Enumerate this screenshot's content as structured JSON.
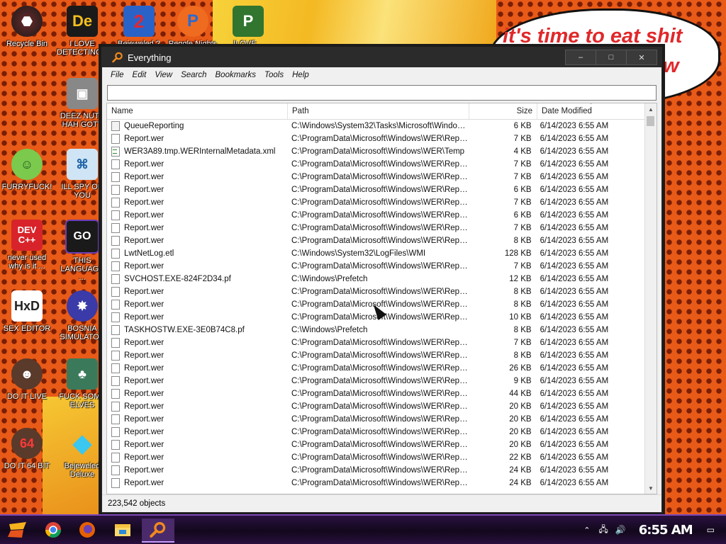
{
  "speech_bubble": {
    "line1": "it's time to eat shit",
    "line2": "w"
  },
  "desktop_icons": [
    {
      "label": "Recycle Bin"
    },
    {
      "label": "I LOVE DETECTING..."
    },
    {
      "label": "Bejeweled 2"
    },
    {
      "label": "Peggle Nights"
    },
    {
      "label": "ILOVE..."
    },
    {
      "label": "DEEZ NUTS HAH GOTT"
    },
    {
      "label": "FURRYFUCK!"
    },
    {
      "label": "ILL SPY ON YOU"
    },
    {
      "label": "never used why is it ..."
    },
    {
      "label": "THIS LANGUAGE ..."
    },
    {
      "label": "SEX EDITOR"
    },
    {
      "label": "BOSNIA SIMULATOR"
    },
    {
      "label": "DO IT LIVE"
    },
    {
      "label": "FUCK SOME ELVES"
    },
    {
      "label": "DO IT 64 BIT"
    },
    {
      "label": "Bejeweled Deluxe"
    }
  ],
  "window": {
    "title": "Everything",
    "minimize": "–",
    "maximize": "□",
    "close": "✕",
    "menu": [
      "File",
      "Edit",
      "View",
      "Search",
      "Bookmarks",
      "Tools",
      "Help"
    ],
    "search": {
      "value": "",
      "placeholder": ""
    },
    "columns": {
      "name": "Name",
      "path": "Path",
      "size": "Size",
      "date": "Date Modified"
    },
    "rows": [
      {
        "icon": "folder",
        "name": "QueueReporting",
        "path": "C:\\Windows\\System32\\Tasks\\Microsoft\\Windows...",
        "size": "6 KB",
        "date": "6/14/2023 6:55 AM"
      },
      {
        "icon": "file",
        "name": "Report.wer",
        "path": "C:\\ProgramData\\Microsoft\\Windows\\WER\\Report...",
        "size": "7 KB",
        "date": "6/14/2023 6:55 AM"
      },
      {
        "icon": "xml",
        "name": "WER3A89.tmp.WERInternalMetadata.xml",
        "path": "C:\\ProgramData\\Microsoft\\Windows\\WER\\Temp",
        "size": "4 KB",
        "date": "6/14/2023 6:55 AM"
      },
      {
        "icon": "file",
        "name": "Report.wer",
        "path": "C:\\ProgramData\\Microsoft\\Windows\\WER\\Report...",
        "size": "7 KB",
        "date": "6/14/2023 6:55 AM"
      },
      {
        "icon": "file",
        "name": "Report.wer",
        "path": "C:\\ProgramData\\Microsoft\\Windows\\WER\\Report...",
        "size": "7 KB",
        "date": "6/14/2023 6:55 AM"
      },
      {
        "icon": "file",
        "name": "Report.wer",
        "path": "C:\\ProgramData\\Microsoft\\Windows\\WER\\Report...",
        "size": "6 KB",
        "date": "6/14/2023 6:55 AM"
      },
      {
        "icon": "file",
        "name": "Report.wer",
        "path": "C:\\ProgramData\\Microsoft\\Windows\\WER\\Report...",
        "size": "7 KB",
        "date": "6/14/2023 6:55 AM"
      },
      {
        "icon": "file",
        "name": "Report.wer",
        "path": "C:\\ProgramData\\Microsoft\\Windows\\WER\\Report...",
        "size": "6 KB",
        "date": "6/14/2023 6:55 AM"
      },
      {
        "icon": "file",
        "name": "Report.wer",
        "path": "C:\\ProgramData\\Microsoft\\Windows\\WER\\Report...",
        "size": "7 KB",
        "date": "6/14/2023 6:55 AM"
      },
      {
        "icon": "file",
        "name": "Report.wer",
        "path": "C:\\ProgramData\\Microsoft\\Windows\\WER\\Report...",
        "size": "8 KB",
        "date": "6/14/2023 6:55 AM"
      },
      {
        "icon": "file",
        "name": "LwtNetLog.etl",
        "path": "C:\\Windows\\System32\\LogFiles\\WMI",
        "size": "128 KB",
        "date": "6/14/2023 6:55 AM"
      },
      {
        "icon": "file",
        "name": "Report.wer",
        "path": "C:\\ProgramData\\Microsoft\\Windows\\WER\\Report...",
        "size": "7 KB",
        "date": "6/14/2023 6:55 AM"
      },
      {
        "icon": "file",
        "name": "SVCHOST.EXE-824F2D34.pf",
        "path": "C:\\Windows\\Prefetch",
        "size": "12 KB",
        "date": "6/14/2023 6:55 AM"
      },
      {
        "icon": "file",
        "name": "Report.wer",
        "path": "C:\\ProgramData\\Microsoft\\Windows\\WER\\Report...",
        "size": "8 KB",
        "date": "6/14/2023 6:55 AM"
      },
      {
        "icon": "file",
        "name": "Report.wer",
        "path": "C:\\ProgramData\\Microsoft\\Windows\\WER\\Report...",
        "size": "8 KB",
        "date": "6/14/2023 6:55 AM"
      },
      {
        "icon": "file",
        "name": "Report.wer",
        "path": "C:\\ProgramData\\Microsoft\\Windows\\WER\\Report...",
        "size": "10 KB",
        "date": "6/14/2023 6:55 AM"
      },
      {
        "icon": "file",
        "name": "TASKHOSTW.EXE-3E0B74C8.pf",
        "path": "C:\\Windows\\Prefetch",
        "size": "8 KB",
        "date": "6/14/2023 6:55 AM"
      },
      {
        "icon": "file",
        "name": "Report.wer",
        "path": "C:\\ProgramData\\Microsoft\\Windows\\WER\\Report...",
        "size": "7 KB",
        "date": "6/14/2023 6:55 AM"
      },
      {
        "icon": "file",
        "name": "Report.wer",
        "path": "C:\\ProgramData\\Microsoft\\Windows\\WER\\Report...",
        "size": "8 KB",
        "date": "6/14/2023 6:55 AM"
      },
      {
        "icon": "file",
        "name": "Report.wer",
        "path": "C:\\ProgramData\\Microsoft\\Windows\\WER\\Report...",
        "size": "26 KB",
        "date": "6/14/2023 6:55 AM"
      },
      {
        "icon": "file",
        "name": "Report.wer",
        "path": "C:\\ProgramData\\Microsoft\\Windows\\WER\\Report...",
        "size": "9 KB",
        "date": "6/14/2023 6:55 AM"
      },
      {
        "icon": "file",
        "name": "Report.wer",
        "path": "C:\\ProgramData\\Microsoft\\Windows\\WER\\Report...",
        "size": "44 KB",
        "date": "6/14/2023 6:55 AM"
      },
      {
        "icon": "file",
        "name": "Report.wer",
        "path": "C:\\ProgramData\\Microsoft\\Windows\\WER\\Report...",
        "size": "20 KB",
        "date": "6/14/2023 6:55 AM"
      },
      {
        "icon": "file",
        "name": "Report.wer",
        "path": "C:\\ProgramData\\Microsoft\\Windows\\WER\\Report...",
        "size": "20 KB",
        "date": "6/14/2023 6:55 AM"
      },
      {
        "icon": "file",
        "name": "Report.wer",
        "path": "C:\\ProgramData\\Microsoft\\Windows\\WER\\Report...",
        "size": "20 KB",
        "date": "6/14/2023 6:55 AM"
      },
      {
        "icon": "file",
        "name": "Report.wer",
        "path": "C:\\ProgramData\\Microsoft\\Windows\\WER\\Report...",
        "size": "20 KB",
        "date": "6/14/2023 6:55 AM"
      },
      {
        "icon": "file",
        "name": "Report.wer",
        "path": "C:\\ProgramData\\Microsoft\\Windows\\WER\\Report...",
        "size": "22 KB",
        "date": "6/14/2023 6:55 AM"
      },
      {
        "icon": "file",
        "name": "Report.wer",
        "path": "C:\\ProgramData\\Microsoft\\Windows\\WER\\Report...",
        "size": "24 KB",
        "date": "6/14/2023 6:55 AM"
      },
      {
        "icon": "file",
        "name": "Report.wer",
        "path": "C:\\ProgramData\\Microsoft\\Windows\\WER\\Report...",
        "size": "24 KB",
        "date": "6/14/2023 6:55 AM"
      }
    ],
    "status": "223,542 objects"
  },
  "taskbar": {
    "items": [
      "start-icon",
      "chrome-icon",
      "firefox-icon",
      "file-explorer-icon",
      "everything-icon"
    ],
    "clock": "6:55 AM"
  },
  "colors": {
    "accent": "#7c47b7",
    "background": "#e85a17",
    "titlebar": "#2b2b2b"
  }
}
